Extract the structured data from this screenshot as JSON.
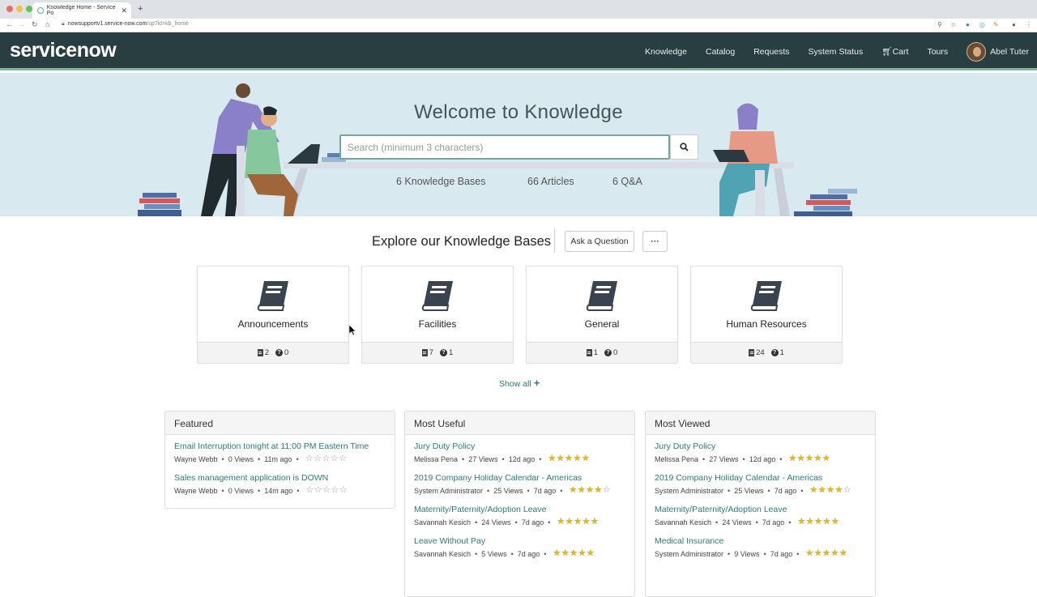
{
  "browser": {
    "tab_title": "Knowledge Home - Service Po",
    "tab_close": "✕",
    "new_tab": "+",
    "url_host": "nowsupportv1.service-now.com",
    "url_path": "/sp?id=kb_home"
  },
  "header": {
    "logo": "servicenow",
    "nav": [
      "Knowledge",
      "Catalog",
      "Requests",
      "System Status"
    ],
    "cart_label": "Cart",
    "tours_label": "Tours",
    "user_name": "Abel Tuter"
  },
  "hero": {
    "title": "Welcome to Knowledge",
    "search_placeholder": "Search (minimum 3 characters)",
    "stats": [
      "6 Knowledge Bases",
      "66 Articles",
      "6 Q&A"
    ]
  },
  "explore": {
    "title": "Explore our Knowledge Bases",
    "ask_button": "Ask a Question",
    "more_button": "···",
    "show_all": "Show all"
  },
  "knowledge_bases": [
    {
      "name": "Announcements",
      "articles": "2",
      "questions": "0"
    },
    {
      "name": "Facilities",
      "articles": "7",
      "questions": "1"
    },
    {
      "name": "General",
      "articles": "1",
      "questions": "0"
    },
    {
      "name": "Human Resources",
      "articles": "24",
      "questions": "1"
    }
  ],
  "panels": [
    {
      "title": "Featured",
      "articles": [
        {
          "title": "Email Interruption tonight at 11:00 PM Eastern Time",
          "author": "Wayne Webb",
          "views": "0 Views",
          "age": "11m ago",
          "rating": 0
        },
        {
          "title": "Sales management application is DOWN",
          "author": "Wayne Webb",
          "views": "0 Views",
          "age": "14m ago",
          "rating": 0
        }
      ]
    },
    {
      "title": "Most Useful",
      "articles": [
        {
          "title": "Jury Duty Policy",
          "author": "Melissa Pena",
          "views": "27 Views",
          "age": "12d ago",
          "rating": 5
        },
        {
          "title": "2019 Company Holiday Calendar - Americas",
          "author": "System Administrator",
          "views": "25 Views",
          "age": "7d ago",
          "rating": 4
        },
        {
          "title": "Maternity/Paternity/Adoption Leave",
          "author": "Savannah Kesich",
          "views": "24 Views",
          "age": "7d ago",
          "rating": 5
        },
        {
          "title": "Leave Without Pay",
          "author": "Savannah Kesich",
          "views": "5 Views",
          "age": "7d ago",
          "rating": 5
        }
      ]
    },
    {
      "title": "Most Viewed",
      "articles": [
        {
          "title": "Jury Duty Policy",
          "author": "Melissa Pena",
          "views": "27 Views",
          "age": "12d ago",
          "rating": 5
        },
        {
          "title": "2019 Company Holiday Calendar - Americas",
          "author": "System Administrator",
          "views": "25 Views",
          "age": "7d ago",
          "rating": 4
        },
        {
          "title": "Maternity/Paternity/Adoption Leave",
          "author": "Savannah Kesich",
          "views": "24 Views",
          "age": "7d ago",
          "rating": 5
        },
        {
          "title": "Medical Insurance",
          "author": "System Administrator",
          "views": "9 Views",
          "age": "7d ago",
          "rating": 5
        }
      ]
    }
  ],
  "colors": {
    "header_bg": "#293e40",
    "accent": "#81b5a1",
    "link": "#2b7a78",
    "hero_bg": "#d9e9f0",
    "star": "#e5b820"
  }
}
